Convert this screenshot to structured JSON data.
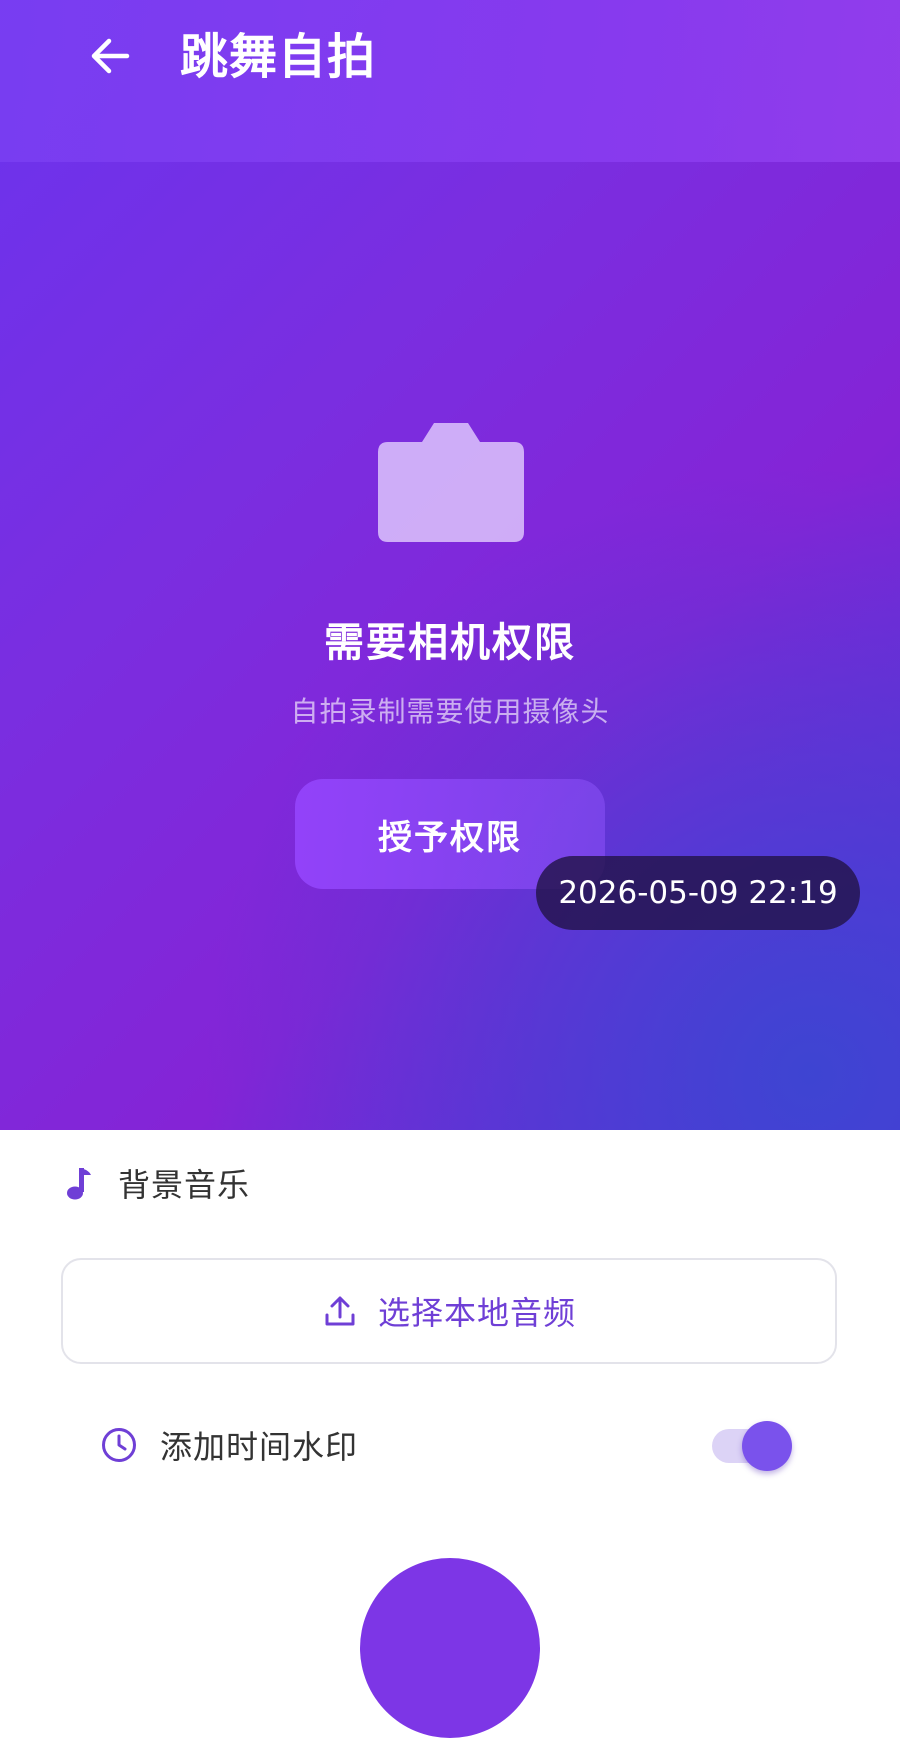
{
  "header": {
    "title": "跳舞自拍",
    "back_icon": "arrow-left-icon"
  },
  "camera": {
    "icon": "camera-icon",
    "permission_title": "需要相机权限",
    "permission_desc": "自拍录制需要使用摄像头",
    "grant_button_label": "授予权限",
    "timestamp": "2026-05-09 22:19"
  },
  "music": {
    "icon": "music-note-icon",
    "label": "背景音乐",
    "select_icon": "upload-icon",
    "select_label": "选择本地音频"
  },
  "watermark": {
    "icon": "clock-icon",
    "label": "添加时间水印",
    "enabled": true
  },
  "colors": {
    "accent": "#7a52ec",
    "link": "#6f3fd6",
    "gradient_start": "#6b33ee",
    "gradient_end": "#5a2fd8"
  }
}
